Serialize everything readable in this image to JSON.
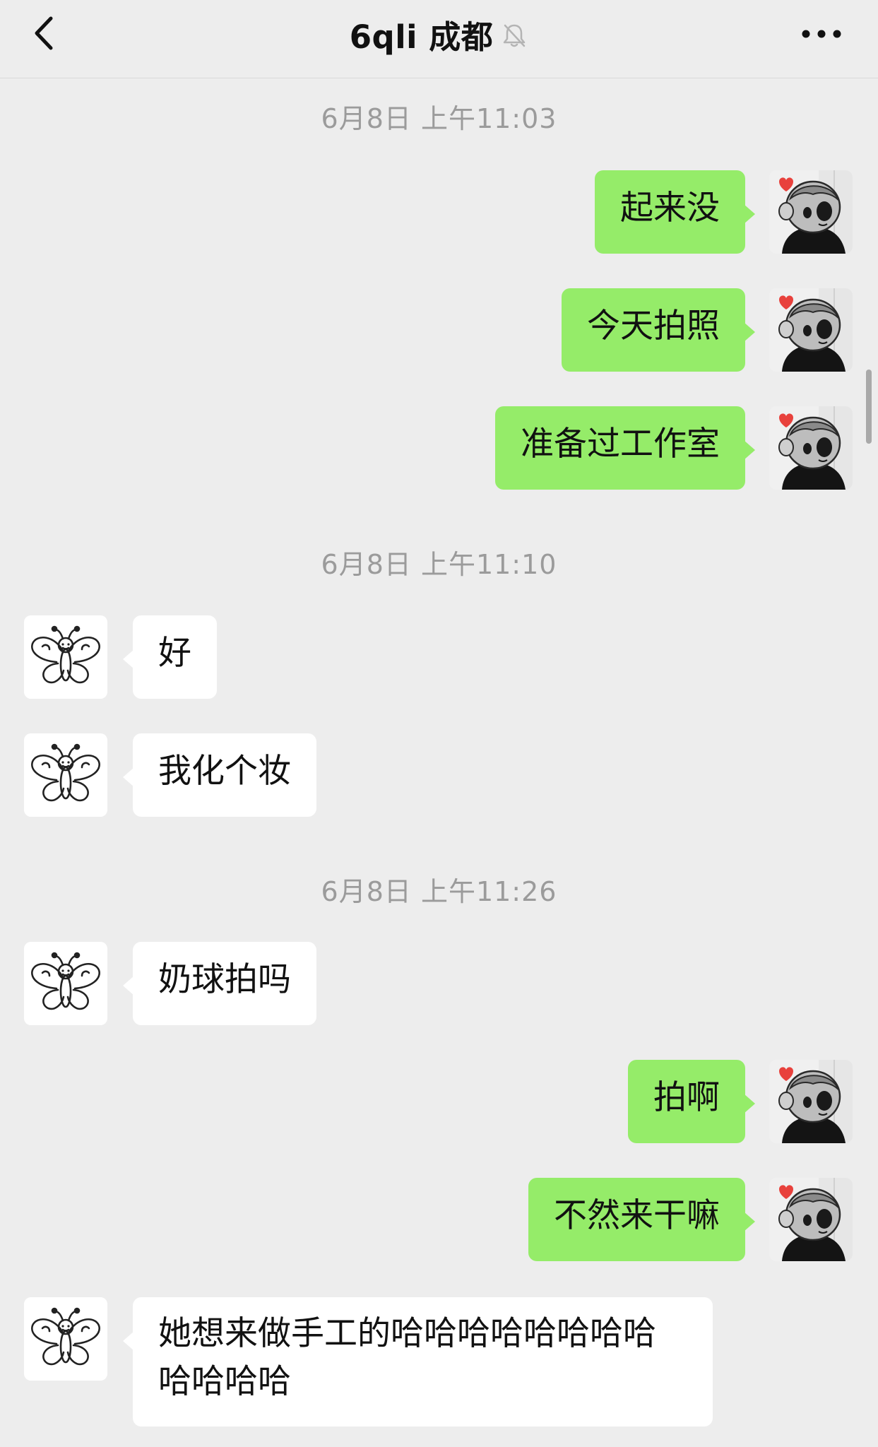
{
  "header": {
    "title": "6qli 成都",
    "back_icon": "chevron-left-icon",
    "mute_icon": "bell-slash-icon",
    "more_icon": "ellipsis-icon"
  },
  "timestamps": [
    "6月8日 上午11:03",
    "6月8日 上午11:10",
    "6月8日 上午11:26"
  ],
  "messages": [
    {
      "side": "sent",
      "text": "起来没"
    },
    {
      "side": "sent",
      "text": "今天拍照"
    },
    {
      "side": "sent",
      "text": "准备过工作室"
    },
    {
      "side": "received",
      "text": "好"
    },
    {
      "side": "received",
      "text": "我化个妆"
    },
    {
      "side": "received",
      "text": "奶球拍吗"
    },
    {
      "side": "sent",
      "text": "拍啊"
    },
    {
      "side": "sent",
      "text": "不然来干嘛"
    },
    {
      "side": "received",
      "text": "她想来做手工的哈哈哈哈哈哈哈哈哈哈哈哈"
    }
  ],
  "colors": {
    "background": "#ededed",
    "sent_bubble": "#95ec69",
    "received_bubble": "#ffffff",
    "timestamp": "#9b9b9b"
  }
}
